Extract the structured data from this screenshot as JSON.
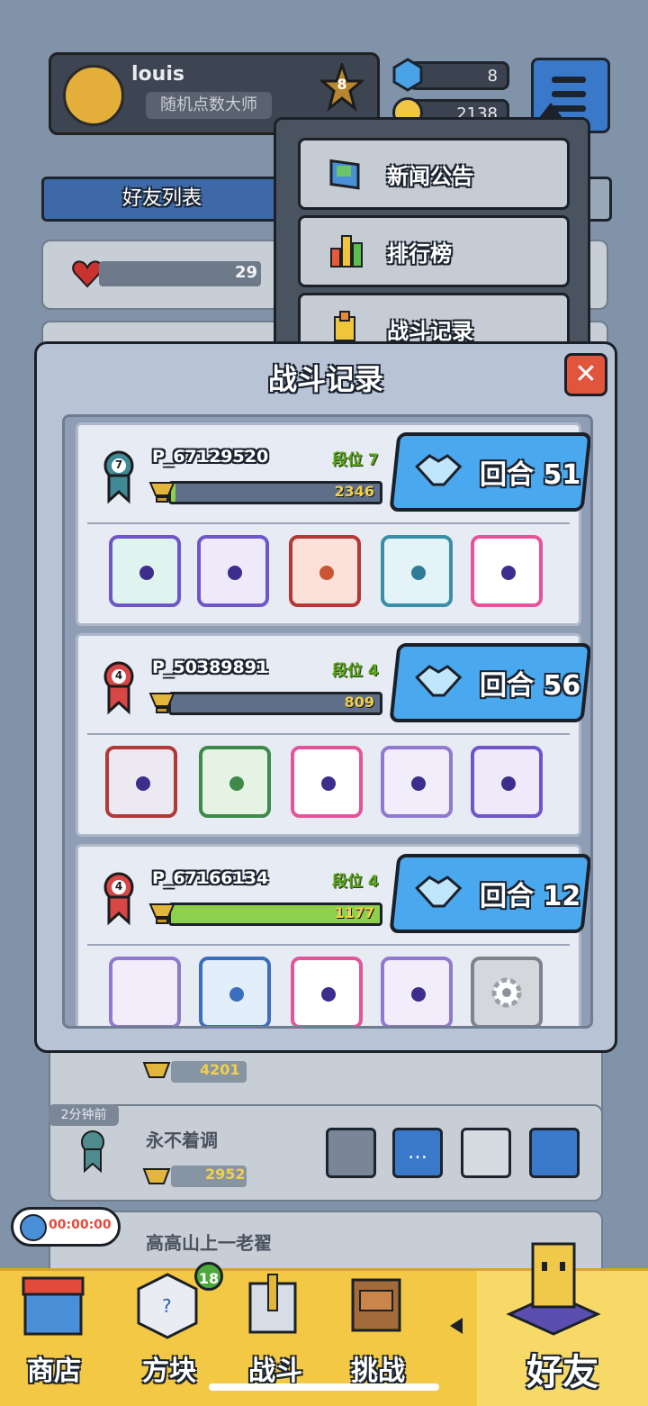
{
  "lobby": {
    "player_name": "louis",
    "player_title": "随机点数大师",
    "star_level": "8",
    "gems": "8",
    "coins": "2138",
    "friends_tab": "好友列表",
    "hearts": "29",
    "friend_rows": [
      {
        "trophy": "4201"
      },
      {
        "time": "2分钟前",
        "name": "永不着调",
        "trophy": "2952"
      },
      {
        "name": "高高山上一老翟"
      }
    ],
    "timer": "00:00:00"
  },
  "dropdown": {
    "items": [
      "新闻公告",
      "排行榜",
      "战斗记录"
    ]
  },
  "modal": {
    "title": "战斗记录",
    "close": "✕",
    "records": [
      {
        "rank": "7",
        "player": "P_67129520",
        "dan": "段位 7",
        "trophy": "2346",
        "round_label": "回合",
        "round": "51",
        "progress": 0.02
      },
      {
        "rank": "4",
        "player": "P_50389891",
        "dan": "段位 4",
        "trophy": "809",
        "round_label": "回合",
        "round": "56",
        "progress": 0.0
      },
      {
        "rank": "4",
        "player": "P_67166134",
        "dan": "段位 4",
        "trophy": "1177",
        "round_label": "回合",
        "round": "12",
        "progress": 1.0
      }
    ]
  },
  "nav": {
    "items": [
      "商店",
      "方块",
      "战斗",
      "挑战",
      "好友"
    ],
    "badge": "18"
  },
  "colors": {
    "accent_blue": "#4aa8ee",
    "nav_yellow": "#f2c845",
    "close_red": "#e0553b",
    "progress_green": "#8dd04c"
  }
}
